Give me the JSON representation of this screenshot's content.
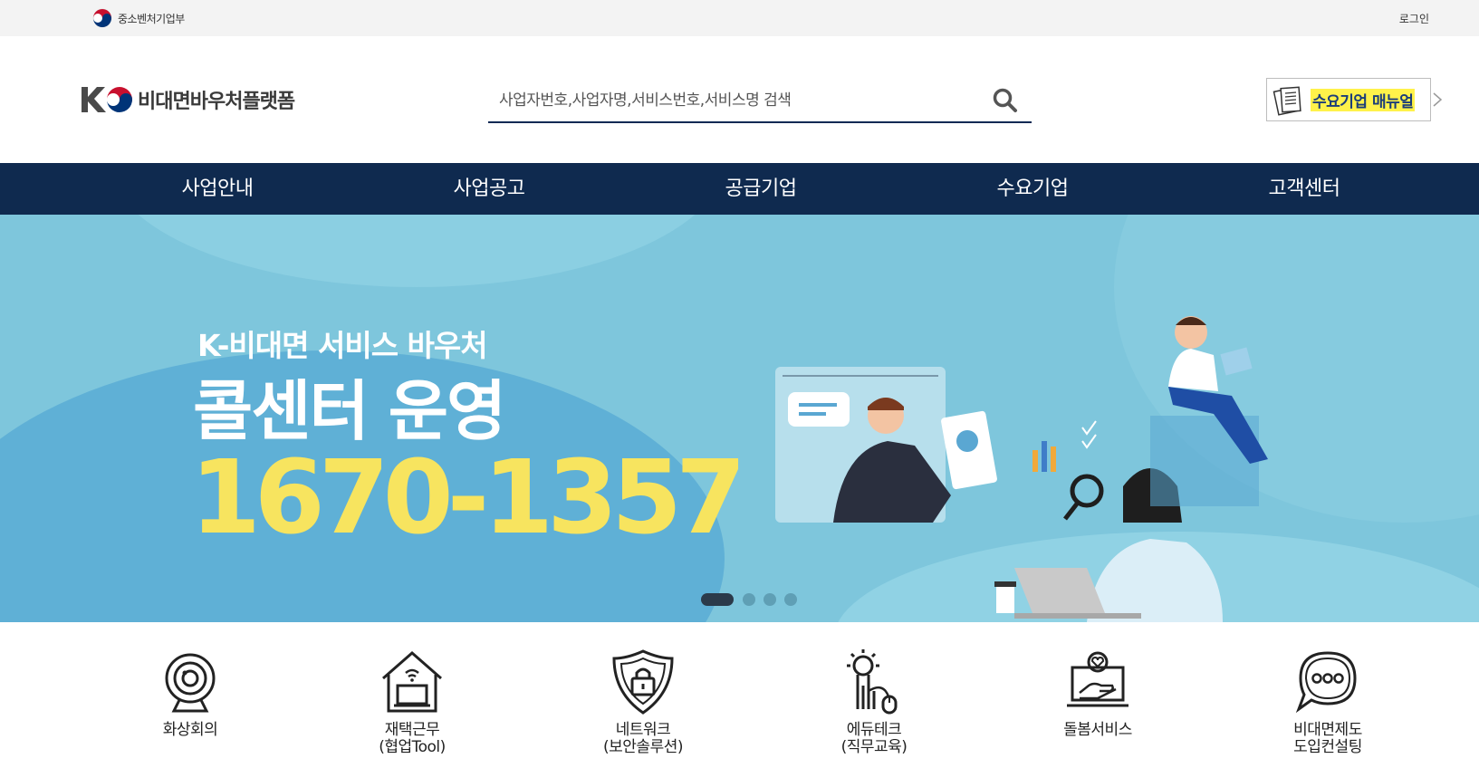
{
  "util": {
    "ministry": "중소벤처기업부",
    "login": "로그인"
  },
  "header": {
    "logo_text": "비대면바우처플랫폼",
    "search_placeholder": "사업자번호,사업자명,서비스번호,서비스명 검색",
    "manual_label": "수요기업 매뉴얼"
  },
  "nav": {
    "items": [
      {
        "label": "사업안내"
      },
      {
        "label": "사업공고"
      },
      {
        "label": "공급기업"
      },
      {
        "label": "수요기업"
      },
      {
        "label": "고객센터"
      }
    ]
  },
  "banner": {
    "subtitle": "K-비대면 서비스 바우처",
    "title": "콜센터 운영",
    "phone": "1670-1357",
    "slide_count": 4,
    "active_slide": 1,
    "colors": {
      "background": "#7ec6dc",
      "phone": "#f7e45f",
      "indicator_active": "#2b3a4a",
      "indicator_inactive": "#5f9fb5"
    }
  },
  "categories": [
    {
      "label": "화상회의",
      "icon": "webcam-icon"
    },
    {
      "label": "재택근무\n(협업Tool)",
      "icon": "home-laptop-icon"
    },
    {
      "label": "네트워크\n(보안솔루션)",
      "icon": "shield-lock-icon"
    },
    {
      "label": "에듀테크\n(직무교육)",
      "icon": "lightbulb-mouse-icon"
    },
    {
      "label": "돌봄서비스",
      "icon": "laptop-heart-hand-icon"
    },
    {
      "label": "비대면제도\n도입컨설팅",
      "icon": "chat-bubble-icon"
    }
  ],
  "colors": {
    "nav_bg": "#0f2a4f",
    "search_underline": "#0e2a54",
    "manual_highlight": "#fff24a"
  }
}
